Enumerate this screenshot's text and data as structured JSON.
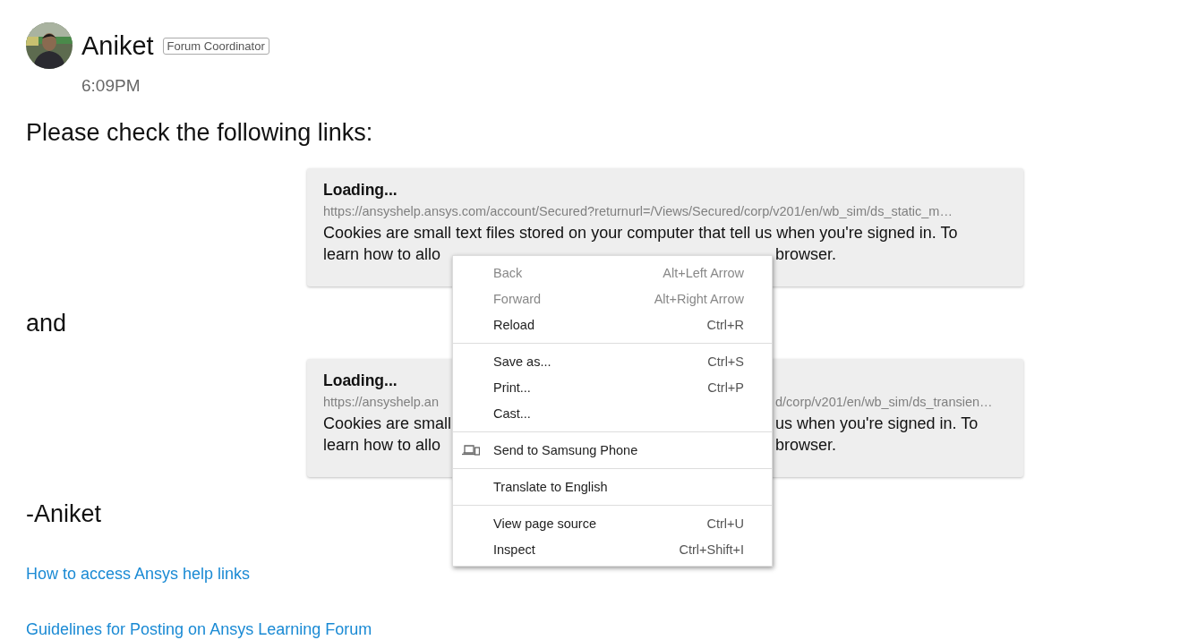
{
  "post": {
    "author": "Aniket",
    "role_badge": "Forum Coordinator",
    "time": "6:09PM"
  },
  "body": [
    {
      "kind": "text",
      "text": "Please check the following links:"
    },
    {
      "kind": "card",
      "title": "Loading...",
      "url": {
        "left": "https://ansyshelp.ansys.com/account/Secured?returnurl=/Views/Secured/corp/v201/en/wb_sim/ds_static_m…"
      },
      "lines": [
        {
          "left": "Cookies are small text files stored on your computer that tell us when you're signed in. To"
        },
        {
          "left": "learn how to allo",
          "right": "browser."
        }
      ]
    },
    {
      "kind": "text",
      "text": "and"
    },
    {
      "kind": "card",
      "title": "Loading...",
      "url": {
        "left": "https://ansyshelp.an",
        "right": "d/corp/v201/en/wb_sim/ds_transien…"
      },
      "lines": [
        {
          "left": "Cookies are small",
          "right": "us when you're signed in. To"
        },
        {
          "left": "learn how to allo",
          "right": "browser."
        }
      ]
    },
    {
      "kind": "text",
      "text": "-Aniket"
    }
  ],
  "links": [
    "How to access Ansys help links",
    "Guidelines for Posting on Ansys Learning Forum"
  ],
  "context_menu": [
    [
      {
        "label": "Back",
        "shortcut": "Alt+Left Arrow",
        "disabled": true
      },
      {
        "label": "Forward",
        "shortcut": "Alt+Right Arrow",
        "disabled": true
      },
      {
        "label": "Reload",
        "shortcut": "Ctrl+R",
        "disabled": false
      }
    ],
    [
      {
        "label": "Save as...",
        "shortcut": "Ctrl+S",
        "disabled": false
      },
      {
        "label": "Print...",
        "shortcut": "Ctrl+P",
        "disabled": false
      },
      {
        "label": "Cast...",
        "disabled": false
      }
    ],
    [
      {
        "label": "Send to Samsung Phone",
        "kind": "with_icon",
        "disabled": false
      }
    ],
    [
      {
        "label": "Translate to English",
        "disabled": false
      }
    ],
    [
      {
        "label": "View page source",
        "shortcut": "Ctrl+U",
        "disabled": false
      },
      {
        "label": "Inspect",
        "shortcut": "Ctrl+Shift+I",
        "disabled": false
      }
    ]
  ]
}
